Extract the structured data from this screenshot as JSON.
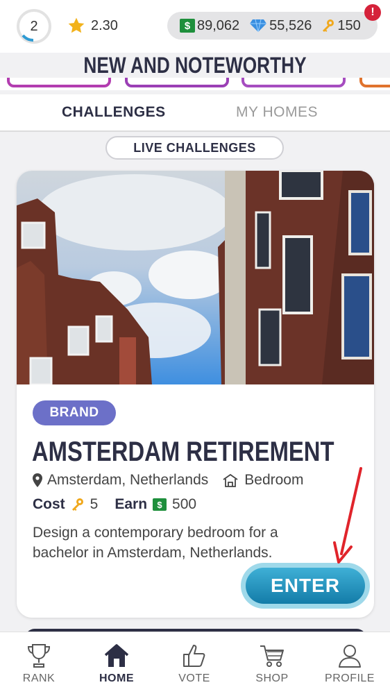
{
  "status": {
    "level": "2",
    "rating": "2.30"
  },
  "currencies": {
    "cash": "89,062",
    "diamonds": "55,526",
    "keys": "150"
  },
  "alert_badge": "!",
  "page_title": "NEW AND NOTEWORTHY",
  "tabs": {
    "challenges": "CHALLENGES",
    "my_homes": "MY HOMES"
  },
  "live_challenges_label": "LIVE CHALLENGES",
  "challenge": {
    "tag": "BRAND",
    "title": "AMSTERDAM RETIREMENT",
    "location": "Amsterdam, Netherlands",
    "room": "Bedroom",
    "cost_label": "Cost",
    "cost_value": "5",
    "earn_label": "Earn",
    "earn_value": "500",
    "description": "Design a contemporary bedroom for a bachelor in Amsterdam, Netherlands.",
    "enter_label": "ENTER"
  },
  "bottom_nav": [
    {
      "label": "RANK",
      "icon": "trophy-icon"
    },
    {
      "label": "HOME",
      "icon": "home-icon",
      "active": true
    },
    {
      "label": "VOTE",
      "icon": "thumbs-up-icon"
    },
    {
      "label": "SHOP",
      "icon": "cart-icon"
    },
    {
      "label": "PROFILE",
      "icon": "user-icon"
    }
  ],
  "colors": {
    "brand_pill": "#6c70c8",
    "enter_button": "#1a8dbb",
    "cash_green": "#1e8f3c",
    "alert_red": "#d5223a",
    "title_navy": "#2d2f45"
  }
}
